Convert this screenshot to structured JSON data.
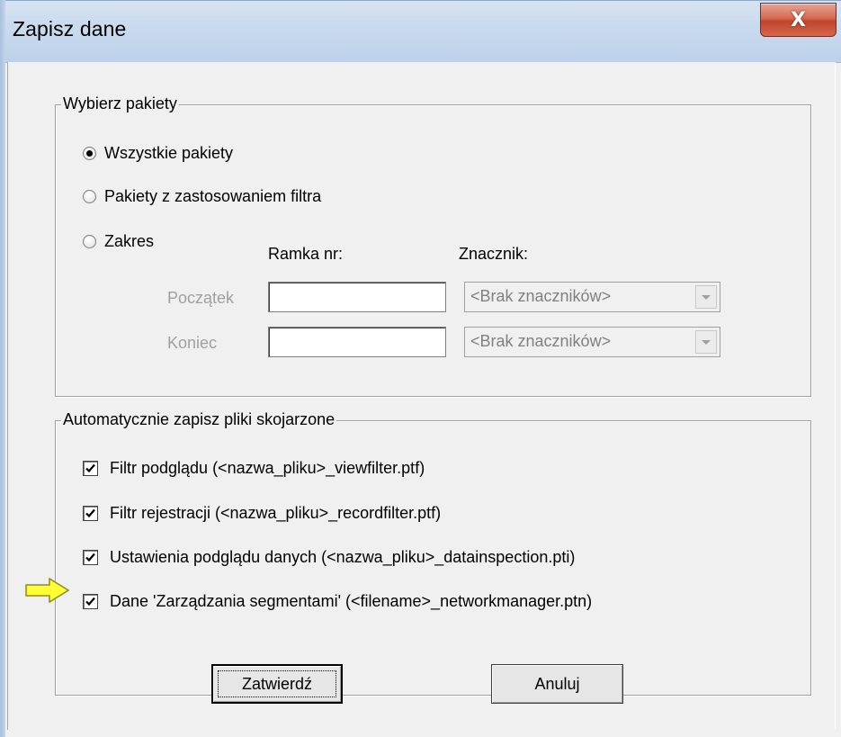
{
  "window": {
    "title": "Zapisz dane",
    "close_glyph": "X"
  },
  "packets_group": {
    "legend": "Wybierz pakiety",
    "options": [
      {
        "label": "Wszystkie pakiety",
        "checked": true
      },
      {
        "label": "Pakiety z zastosowaniem filtra",
        "checked": false
      },
      {
        "label": "Zakres",
        "checked": false
      }
    ],
    "frame_header": "Ramka nr:",
    "marker_header": "Znacznik:",
    "start_label": "Początek",
    "end_label": "Koniec",
    "start_frame_value": "",
    "end_frame_value": "",
    "start_marker_value": "<Brak znaczników>",
    "end_marker_value": "<Brak znaczników>"
  },
  "auto_save_group": {
    "legend": "Automatycznie zapisz pliki skojarzone",
    "items": [
      {
        "label": "Filtr podglądu  (<nazwa_pliku>_viewfilter.ptf)",
        "checked": true
      },
      {
        "label": "Filtr rejestracji  (<nazwa_pliku>_recordfilter.ptf)",
        "checked": true
      },
      {
        "label": "Ustawienia podglądu danych  (<nazwa_pliku>_datainspection.pti)",
        "checked": true
      },
      {
        "label": "Dane 'Zarządzania segmentami' (<filename>_networkmanager.ptn)",
        "checked": true
      }
    ]
  },
  "buttons": {
    "confirm_label": "Zatwierdź",
    "cancel_label": "Anuluj"
  },
  "icons": {
    "close": "close-icon",
    "radio": "radio-icon",
    "checkbox": "checkmark-icon",
    "dropdown": "chevron-down-icon",
    "annotation_arrow": "arrow-right-icon"
  },
  "colors": {
    "annotation_arrow": "#ffff33",
    "close_button": "#c9523a",
    "dialog_background": "#f0f0f0"
  }
}
